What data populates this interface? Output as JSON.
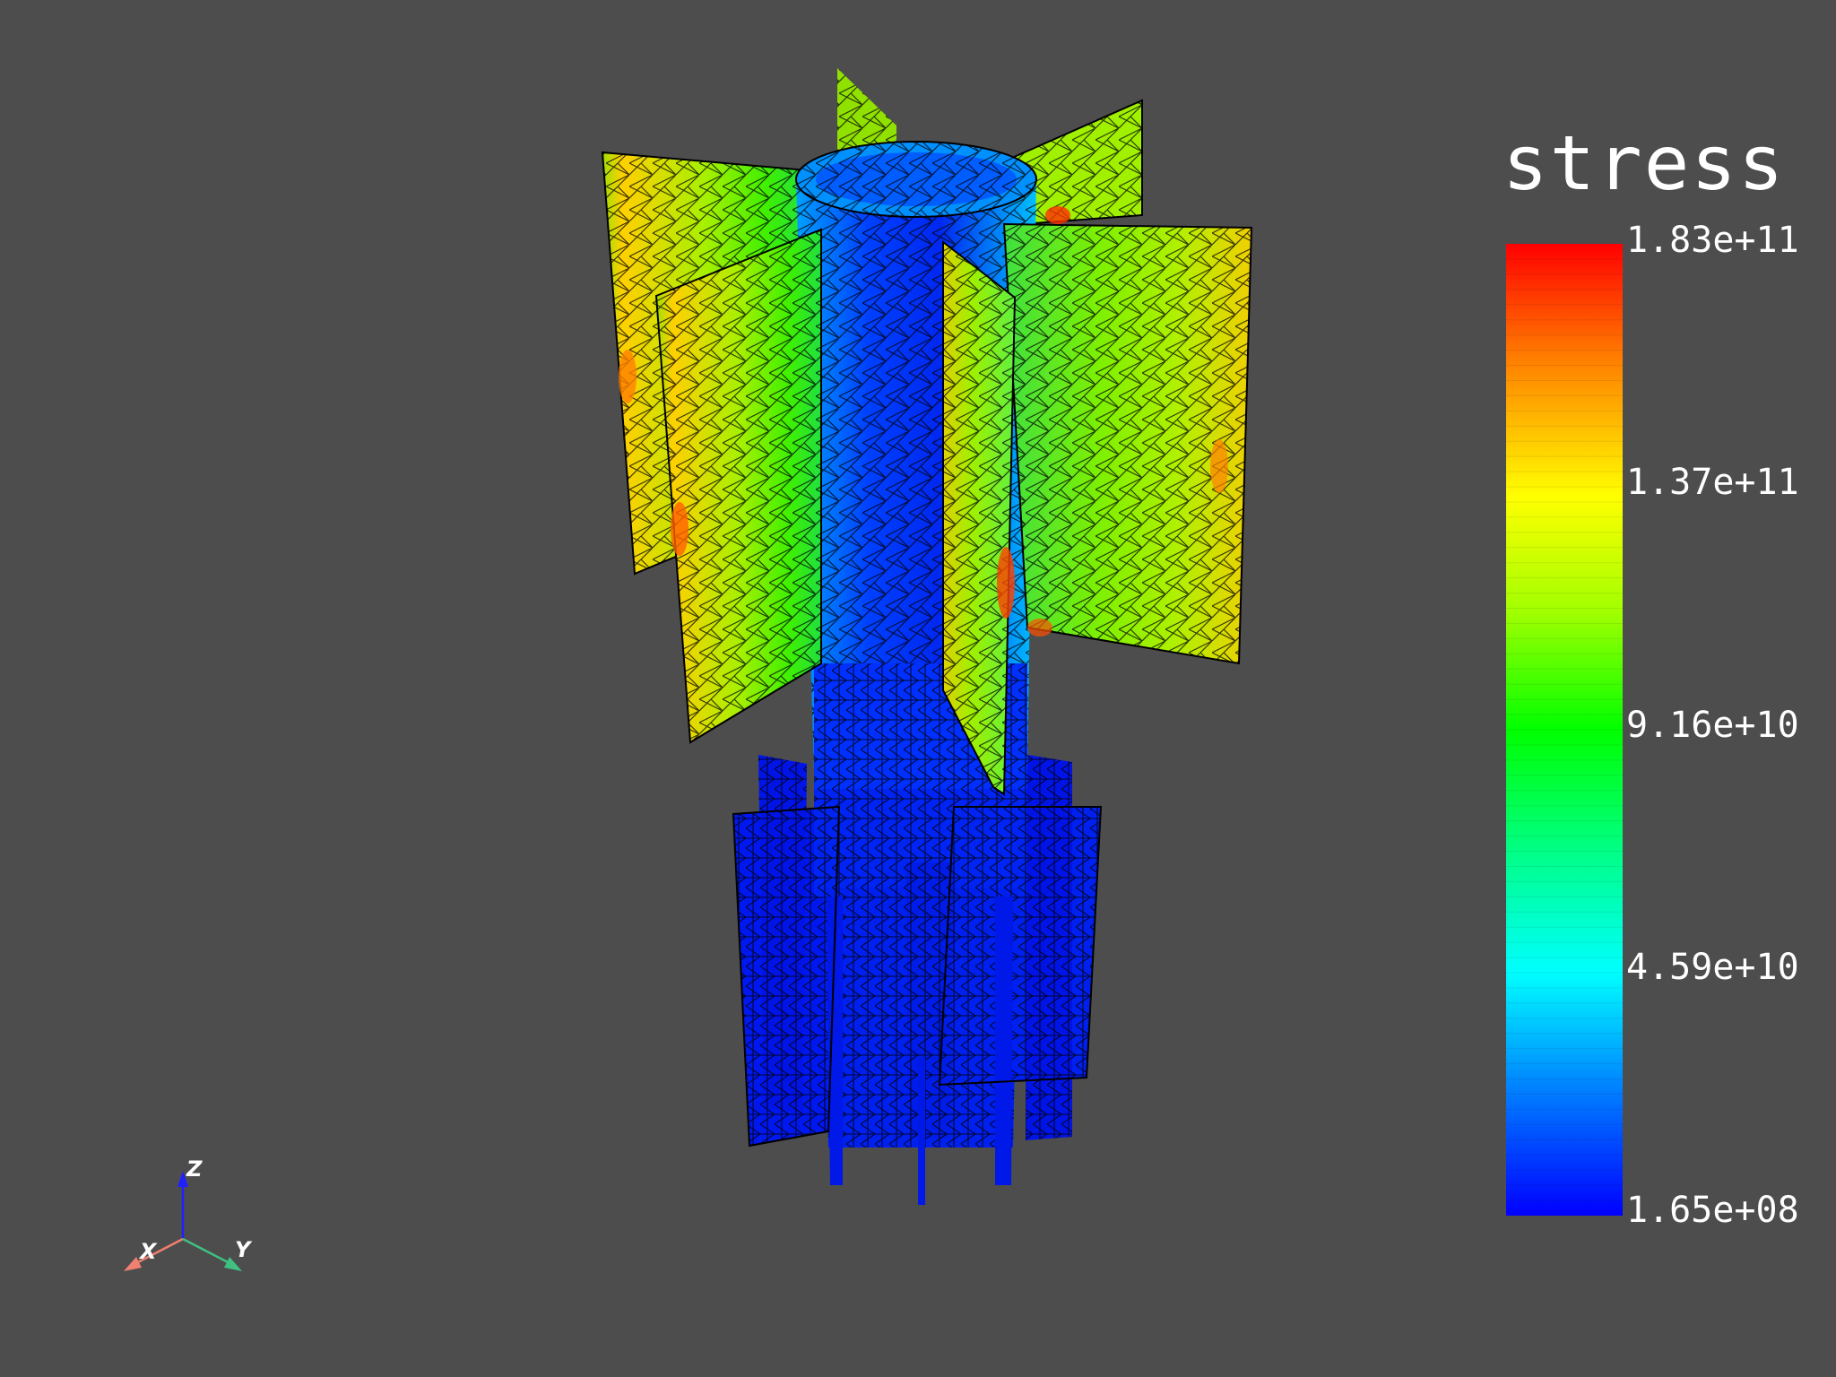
{
  "scalar_bar": {
    "title": "stress",
    "labels": [
      "1.83e+11",
      "1.37e+11",
      "9.16e+10",
      "4.59e+10",
      "1.65e+08"
    ],
    "colors": [
      "#ff0000",
      "#ff8000",
      "#ffff00",
      "#80ff00",
      "#00ff00",
      "#00ff80",
      "#00ffff",
      "#0080ff",
      "#0000ff"
    ]
  },
  "axes": {
    "z": "Z",
    "x": "X",
    "y": "Y"
  },
  "colors": {
    "background": "#4d4d4d",
    "x_axis": "#f08070",
    "y_axis": "#40c080",
    "z_axis": "#2020ff"
  }
}
